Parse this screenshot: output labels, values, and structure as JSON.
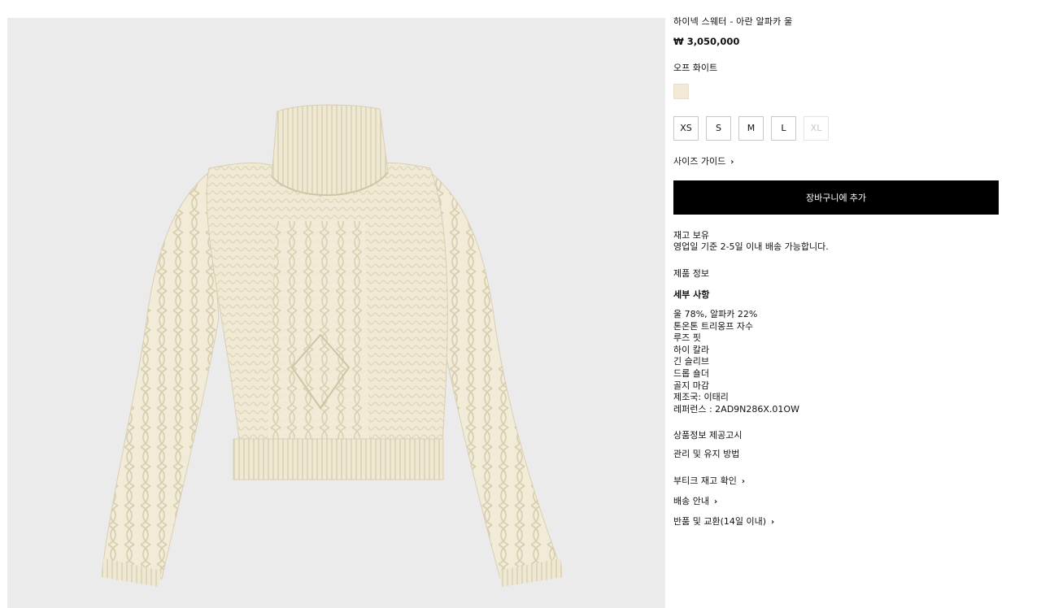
{
  "product": {
    "title": "하이넥 스웨터 - 아란 알파카 울",
    "price": "₩ 3,050,000",
    "color_name": "오프 화이트",
    "color_hex": "#f2ead6",
    "sizes": [
      {
        "label": "XS",
        "available": true
      },
      {
        "label": "S",
        "available": true
      },
      {
        "label": "M",
        "available": true
      },
      {
        "label": "L",
        "available": true
      },
      {
        "label": "XL",
        "available": false
      }
    ],
    "size_guide": "사이즈 가이드",
    "add_to_cart": "장바구니에 추가",
    "stock_status": "재고 보유",
    "delivery_note": "영업일 기준 2-5일 이내 배송 가능합니다.",
    "product_info_label": "제품 정보",
    "details_title": "세부 사항",
    "details": [
      "울 78%, 알파카 22%",
      "톤온톤 트리옹프 자수",
      "루즈 핏",
      "하이 칼라",
      "긴 슬리브",
      "드롭 숄더",
      "골지 마감",
      "제조국: 이태리",
      "레퍼런스 : 2AD9N286X.01OW"
    ],
    "notice_link": "상품정보 제공고시",
    "care_link": "관리 및 유지 방법",
    "links": [
      "부티크 재고 확인",
      "배송 안내",
      "반품 및 교환(14일 이내)"
    ]
  },
  "colors": {
    "accent": "#000000",
    "gallery_bg": "#ebebeb",
    "sweater": "#f1ecd9"
  },
  "icons": {
    "chevron": "chevron-right-icon"
  }
}
